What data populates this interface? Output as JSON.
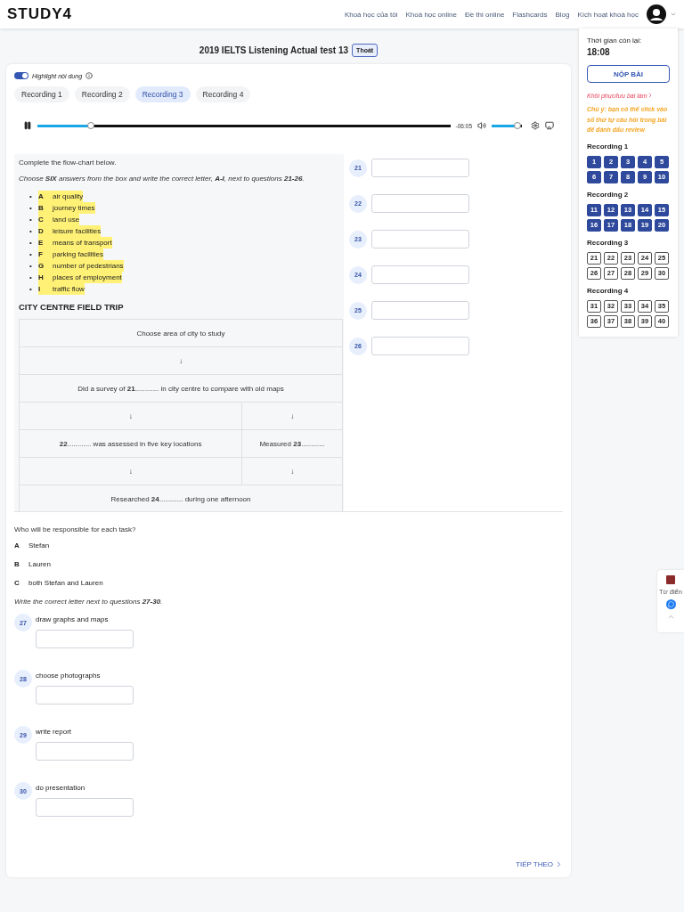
{
  "header": {
    "logo": "STUDY4",
    "nav": [
      "Khoá học của tôi",
      "Khoá học online",
      "Đề thi online",
      "Flashcards",
      "Blog",
      "Kích hoạt khoá học"
    ]
  },
  "test": {
    "title": "2019 IELTS Listening Actual test 13",
    "exit_button": "Thoát"
  },
  "highlight": {
    "label": "Highlight nội dung",
    "on": true
  },
  "tabs": [
    {
      "label": "Recording 1",
      "selected": false
    },
    {
      "label": "Recording 2",
      "selected": false
    },
    {
      "label": "Recording 3",
      "selected": true
    },
    {
      "label": "Recording 4",
      "selected": false
    }
  ],
  "audio": {
    "playing": true,
    "level": 0.13,
    "time": "-06:05",
    "volume": {
      "level": 0.85
    }
  },
  "part1": {
    "instruction": "Complete the flow-chart below.",
    "instruction2": "Choose **SIX** answers from the box and write the correct letter, **A-I**, next to questions **21-26**.",
    "options": [
      {
        "marker": "•",
        "letter": "A",
        "text": "air quality"
      },
      {
        "marker": "•",
        "letter": "B",
        "text": "journey times"
      },
      {
        "marker": "•",
        "letter": "C",
        "text": "land use"
      },
      {
        "marker": "•",
        "letter": "D",
        "text": "leisure facilities"
      },
      {
        "marker": "•",
        "letter": "E",
        "text": "means of transport"
      },
      {
        "marker": "•",
        "letter": "F",
        "text": "parking facilities"
      },
      {
        "marker": "•",
        "letter": "G",
        "text": "number of pedestrians"
      },
      {
        "marker": "•",
        "letter": "H",
        "text": "places of employment"
      },
      {
        "marker": "•",
        "letter": "I",
        "text": "traffic flow"
      }
    ],
    "heading": "CITY CENTRE FIELD TRIP",
    "flowchart": [
      {
        "cells": [
          "Choose area of city to study"
        ]
      },
      {
        "cells": [
          "↓"
        ]
      },
      {
        "cells": [
          "Did a survey of **21**............ in city centre to compare with old maps"
        ]
      },
      {
        "cells": [
          "↓",
          "↓"
        ]
      },
      {
        "cells": [
          "**22**............ was assessed in five key locations",
          "Measured **23**............"
        ]
      },
      {
        "cells": [
          "↓",
          "↓"
        ]
      },
      {
        "cells": [
          "Researched **24**............ during one afternoon"
        ]
      }
    ],
    "answers": [
      {
        "number": "21"
      },
      {
        "number": "22"
      },
      {
        "number": "23"
      },
      {
        "number": "24"
      },
      {
        "number": "25"
      },
      {
        "number": "26"
      }
    ]
  },
  "part2": {
    "question": "Who will be responsible for each task?",
    "options": [
      {
        "letter": "A",
        "text": "Stefan"
      },
      {
        "letter": "B",
        "text": "Lauren"
      },
      {
        "letter": "C",
        "text": "both Stefan and Lauren"
      }
    ],
    "instruction": "Write the correct letter next to questions **27-30**.",
    "questions": [
      {
        "number": "27",
        "text": "draw graphs and maps"
      },
      {
        "number": "28",
        "text": "choose photographs"
      },
      {
        "number": "29",
        "text": "write report"
      },
      {
        "number": "30",
        "text": "do presentation"
      }
    ]
  },
  "next_button": "TIẾP THEO",
  "sidebar": {
    "timer_label": "Thời gian còn lại:",
    "timer": "18:08",
    "submit_button": "NỘP BÀI",
    "restore_link": "Khôi phục/lưu bài làm",
    "note": "Chú ý: bạn có thể click vào số thứ tự câu hỏi trong bài để đánh dấu review",
    "groups": [
      {
        "title": "Recording 1",
        "numbers": [
          {
            "label": "1",
            "answered": true
          },
          {
            "label": "2",
            "answered": true
          },
          {
            "label": "3",
            "answered": true
          },
          {
            "label": "4",
            "answered": true
          },
          {
            "label": "5",
            "answered": true
          },
          {
            "label": "6",
            "answered": true
          },
          {
            "label": "7",
            "answered": true
          },
          {
            "label": "8",
            "answered": true
          },
          {
            "label": "9",
            "answered": true
          },
          {
            "label": "10",
            "answered": true
          }
        ]
      },
      {
        "title": "Recording 2",
        "numbers": [
          {
            "label": "11",
            "answered": true
          },
          {
            "label": "12",
            "answered": true
          },
          {
            "label": "13",
            "answered": true
          },
          {
            "label": "14",
            "answered": true
          },
          {
            "label": "15",
            "answered": true
          },
          {
            "label": "16",
            "answered": true
          },
          {
            "label": "17",
            "answered": true
          },
          {
            "label": "18",
            "answered": true
          },
          {
            "label": "19",
            "answered": true
          },
          {
            "label": "20",
            "answered": true
          }
        ]
      },
      {
        "title": "Recording 3",
        "numbers": [
          {
            "label": "21",
            "answered": false
          },
          {
            "label": "22",
            "answered": false
          },
          {
            "label": "23",
            "answered": false
          },
          {
            "label": "24",
            "answered": false
          },
          {
            "label": "25",
            "answered": false
          },
          {
            "label": "26",
            "answered": false
          },
          {
            "label": "27",
            "answered": false
          },
          {
            "label": "28",
            "answered": false
          },
          {
            "label": "29",
            "answered": false
          },
          {
            "label": "30",
            "answered": false
          }
        ]
      },
      {
        "title": "Recording 4",
        "numbers": [
          {
            "label": "31",
            "answered": false
          },
          {
            "label": "32",
            "answered": false
          },
          {
            "label": "33",
            "answered": false
          },
          {
            "label": "34",
            "answered": false
          },
          {
            "label": "35",
            "answered": false
          },
          {
            "label": "36",
            "answered": false
          },
          {
            "label": "37",
            "answered": false
          },
          {
            "label": "38",
            "answered": false
          },
          {
            "label": "39",
            "answered": false
          },
          {
            "label": "40",
            "answered": false
          }
        ]
      }
    ]
  },
  "widget": {
    "dictionary": "Từ điển"
  }
}
